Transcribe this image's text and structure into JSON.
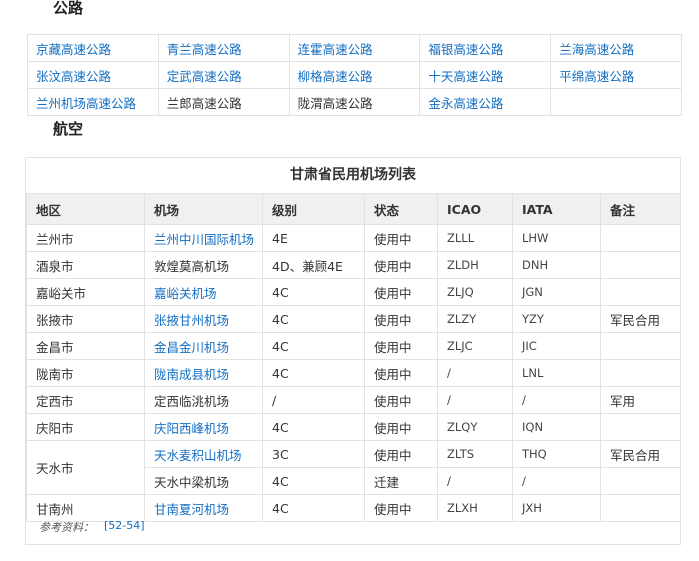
{
  "highway": {
    "title": "公路",
    "rows": [
      [
        {
          "text": "京藏高速公路",
          "link": true
        },
        {
          "text": "青兰高速公路",
          "link": true
        },
        {
          "text": "连霍高速公路",
          "link": true
        },
        {
          "text": "福银高速公路",
          "link": true
        },
        {
          "text": "兰海高速公路",
          "link": true
        }
      ],
      [
        {
          "text": "张汶高速公路",
          "link": true
        },
        {
          "text": "定武高速公路",
          "link": true
        },
        {
          "text": "柳格高速公路",
          "link": true
        },
        {
          "text": "十天高速公路",
          "link": true
        },
        {
          "text": "平绵高速公路",
          "link": true
        }
      ],
      [
        {
          "text": "兰州机场高速公路",
          "link": true
        },
        {
          "text": "兰郎高速公路",
          "link": false
        },
        {
          "text": "陇渭高速公路",
          "link": false
        },
        {
          "text": "金永高速公路",
          "link": true
        },
        {
          "text": "",
          "link": false
        }
      ]
    ]
  },
  "aviation": {
    "title": "航空",
    "table_caption": "甘肃省民用机场列表",
    "headers": [
      "地区",
      "机场",
      "级别",
      "状态",
      "ICAO",
      "IATA",
      "备注"
    ],
    "rows": [
      {
        "region": "兰州市",
        "airport": "兰州中川国际机场",
        "airport_link": true,
        "grade": "4E",
        "status": "使用中",
        "icao": "ZLLL",
        "iata": "LHW",
        "note": ""
      },
      {
        "region": "酒泉市",
        "airport": "敦煌莫高机场",
        "airport_link": false,
        "grade": "4D、兼顾4E",
        "status": "使用中",
        "icao": "ZLDH",
        "iata": "DNH",
        "note": ""
      },
      {
        "region": "嘉峪关市",
        "airport": "嘉峪关机场",
        "airport_link": true,
        "grade": "4C",
        "status": "使用中",
        "icao": "ZLJQ",
        "iata": "JGN",
        "note": ""
      },
      {
        "region": "张掖市",
        "airport": "张掖甘州机场",
        "airport_link": true,
        "grade": "4C",
        "status": "使用中",
        "icao": "ZLZY",
        "iata": "YZY",
        "note": "军民合用"
      },
      {
        "region": "金昌市",
        "airport": "金昌金川机场",
        "airport_link": true,
        "grade": "4C",
        "status": "使用中",
        "icao": "ZLJC",
        "iata": "JIC",
        "note": ""
      },
      {
        "region": "陇南市",
        "airport": "陇南成县机场",
        "airport_link": true,
        "grade": "4C",
        "status": "使用中",
        "icao": "/",
        "iata": "LNL",
        "note": ""
      },
      {
        "region": "定西市",
        "airport": "定西临洮机场",
        "airport_link": false,
        "grade": "/",
        "status": "使用中",
        "icao": "/",
        "iata": "/",
        "note": "军用"
      },
      {
        "region": "庆阳市",
        "airport": "庆阳西峰机场",
        "airport_link": true,
        "grade": "4C",
        "status": "使用中",
        "icao": "ZLQY",
        "iata": "IQN",
        "note": ""
      },
      {
        "region": "天水市",
        "airport": "天水麦积山机场",
        "airport_link": true,
        "grade": "3C",
        "status": "使用中",
        "icao": "ZLTS",
        "iata": "THQ",
        "note": "军民合用"
      },
      {
        "region": "",
        "airport": "天水中梁机场",
        "airport_link": false,
        "grade": "4C",
        "status": "迁建",
        "icao": "/",
        "iata": "/",
        "note": ""
      },
      {
        "region": "甘南州",
        "airport": "甘南夏河机场",
        "airport_link": true,
        "grade": "4C",
        "status": "使用中",
        "icao": "ZLXH",
        "iata": "JXH",
        "note": ""
      }
    ],
    "reference_label": "参考资料：",
    "reference_link": "[52-54]"
  },
  "colors": {
    "link": "#136ec2",
    "header_bg": "#f0f0f0",
    "border": "#e2e2e2"
  }
}
